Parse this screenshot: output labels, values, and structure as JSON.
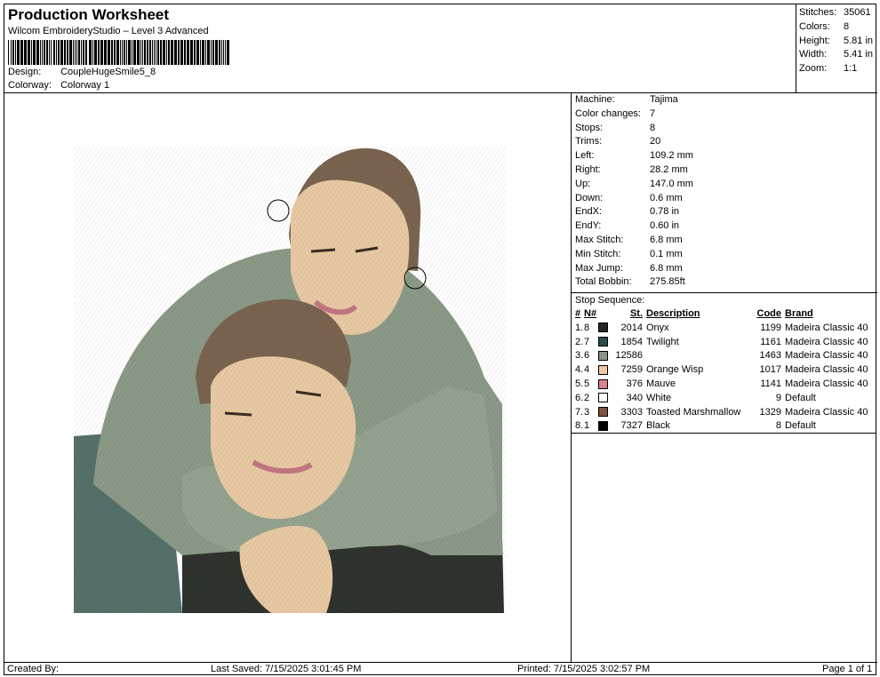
{
  "header": {
    "title": "Production Worksheet",
    "subtitle": "Wilcom EmbroideryStudio – Level 3 Advanced",
    "design_label": "Design:",
    "design_value": "CoupleHugeSmile5_8",
    "colorway_label": "Colorway:",
    "colorway_value": "Colorway 1"
  },
  "summary": [
    {
      "label": "Stitches:",
      "value": "35061"
    },
    {
      "label": "Colors:",
      "value": "8"
    },
    {
      "label": "Height:",
      "value": "5.81 in"
    },
    {
      "label": "Width:",
      "value": "5.41 in"
    },
    {
      "label": "Zoom:",
      "value": "1:1"
    }
  ],
  "machine_info": [
    {
      "label": "Machine:",
      "value": "Tajima"
    },
    {
      "label": "Color changes:",
      "value": "7"
    },
    {
      "label": "Stops:",
      "value": "8"
    },
    {
      "label": "Trims:",
      "value": "20"
    },
    {
      "label": "Left:",
      "value": "109.2 mm"
    },
    {
      "label": "Right:",
      "value": "28.2 mm"
    },
    {
      "label": "Up:",
      "value": "147.0 mm"
    },
    {
      "label": "Down:",
      "value": "0.6 mm"
    },
    {
      "label": "EndX:",
      "value": "0.78 in"
    },
    {
      "label": "EndY:",
      "value": "0.60 in"
    },
    {
      "label": "Max Stitch:",
      "value": "6.8 mm"
    },
    {
      "label": "Min Stitch:",
      "value": "0.1 mm"
    },
    {
      "label": "Max Jump:",
      "value": "6.8 mm"
    },
    {
      "label": "Total Bobbin:",
      "value": "275.85ft"
    }
  ],
  "stop_sequence": {
    "title": "Stop Sequence:",
    "headers": {
      "num": "#",
      "n": "N#",
      "st": "St.",
      "desc": "Description",
      "code": "Code",
      "brand": "Brand"
    },
    "rows": [
      {
        "num": "1.",
        "n": "8",
        "color": "#22282a",
        "st": "2014",
        "desc": "Onyx",
        "code": "1199",
        "brand": "Madeira Classic 40"
      },
      {
        "num": "2.",
        "n": "7",
        "color": "#2e4a4e",
        "st": "1854",
        "desc": "Twilight",
        "code": "1161",
        "brand": "Madeira Classic 40"
      },
      {
        "num": "3.",
        "n": "6",
        "color": "#8a9487",
        "st": "12586",
        "desc": "",
        "code": "1463",
        "brand": "Madeira Classic 40"
      },
      {
        "num": "4.",
        "n": "4",
        "color": "#f2c7a8",
        "st": "7259",
        "desc": "Orange Wisp",
        "code": "1017",
        "brand": "Madeira Classic 40"
      },
      {
        "num": "5.",
        "n": "5",
        "color": "#d9848c",
        "st": "376",
        "desc": "Mauve",
        "code": "1141",
        "brand": "Madeira Classic 40"
      },
      {
        "num": "6.",
        "n": "2",
        "color": "#ffffff",
        "st": "340",
        "desc": "White",
        "code": "9",
        "brand": "Default"
      },
      {
        "num": "7.",
        "n": "3",
        "color": "#7a5442",
        "st": "3303",
        "desc": "Toasted Marshmallow",
        "code": "1329",
        "brand": "Madeira Classic 40"
      },
      {
        "num": "8.",
        "n": "1",
        "color": "#000000",
        "st": "7327",
        "desc": "Black",
        "code": "8",
        "brand": "Default"
      }
    ]
  },
  "footer": {
    "created": "Created By:",
    "saved": "Last Saved: 7/15/2025 3:01:45 PM",
    "printed": "Printed: 7/15/2025 3:02:57 PM",
    "page": "Page 1 of 1"
  },
  "colors": {
    "sweater": "#8a9a86",
    "sweater_dark": "#6d7d6a",
    "hair": "#7a6450",
    "skin": "#e8c9a3",
    "chair": "#55706a",
    "pants": "#2f332e"
  }
}
